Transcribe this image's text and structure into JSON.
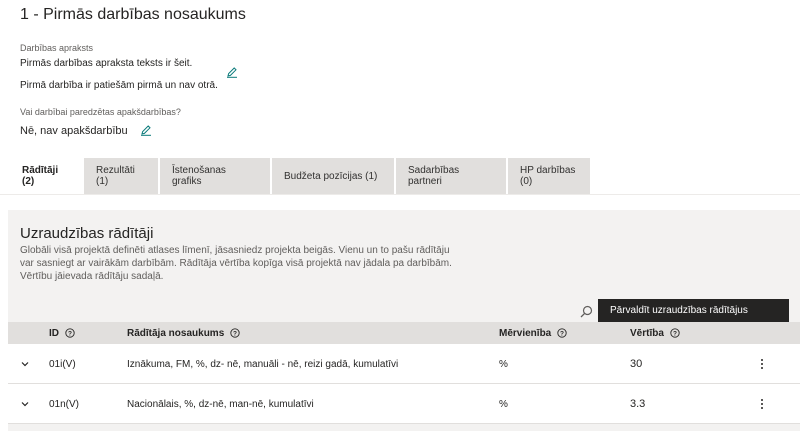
{
  "page": {
    "title": "1 - Pirmās darbības nosaukums"
  },
  "description": {
    "label": "Darbības apraksts",
    "line1": "Pirmās darbības apraksta teksts ir šeit.",
    "line2": "Pirmā darbība ir patiešām pirmā un nav otrā."
  },
  "subactivities": {
    "label": "Vai darbībai paredzētas apakšdarbības?",
    "value": "Nē, nav apakšdarbību"
  },
  "tabs": [
    {
      "label": "Rādītāji (2)",
      "active": true
    },
    {
      "label": "Rezultāti (1)",
      "active": false
    },
    {
      "label": "Īstenošanas grafiks",
      "active": false
    },
    {
      "label": "Budžeta pozīcijas (1)",
      "active": false
    },
    {
      "label": "Sadarbības partneri",
      "active": false
    },
    {
      "label": "HP darbības (0)",
      "active": false
    }
  ],
  "indicators": {
    "title": "Uzraudzības rādītāji",
    "description": "Globāli visā projektā definēti atlases līmenī, jāsasniedz projekta beigās. Vienu un to pašu rādītāju var sasniegt ar vairākām darbībām. Rādītāja vērtība kopīga visā projektā nav jādala pa darbībām. Vērtību jāievada rādītāju sadaļā.",
    "manage_button": "Pārvaldīt uzraudzības rādītājus",
    "columns": {
      "id": "ID",
      "name": "Rādītāja nosaukums",
      "unit": "Mērvienība",
      "value": "Vērtība"
    },
    "rows": [
      {
        "id": "01i(V)",
        "name": "Iznākuma, FM, %, dz- nē, manuāli - nē, reizi gadā, kumulatīvi",
        "unit": "%",
        "value": "30"
      },
      {
        "id": "01n(V)",
        "name": "Nacionālais, %, dz-nē, man-nē, kumulatīvi",
        "unit": "%",
        "value": "3.3"
      }
    ]
  }
}
